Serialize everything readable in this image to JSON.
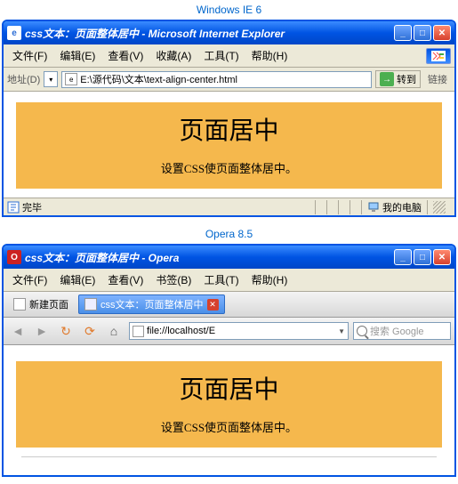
{
  "captions": {
    "ie": "Windows IE 6",
    "opera": "Opera 8.5"
  },
  "ie": {
    "title": "css文本：页面整体居中 - Microsoft Internet Explorer",
    "menu": {
      "file": "文件(F)",
      "edit": "编辑(E)",
      "view": "查看(V)",
      "fav": "收藏(A)",
      "tools": "工具(T)",
      "help": "帮助(H)"
    },
    "addr_label": "地址(D)",
    "url": "E:\\源代码\\文本\\text-align-center.html",
    "go": "转到",
    "links": "链接",
    "heading": "页面居中",
    "subtext": "设置CSS使页面整体居中。",
    "status_done": "完毕",
    "status_zone": "我的电脑"
  },
  "opera": {
    "title": "css文本：页面整体居中 - Opera",
    "menu": {
      "file": "文件(F)",
      "edit": "编辑(E)",
      "view": "查看(V)",
      "bookmarks": "书签(B)",
      "tools": "工具(T)",
      "help": "帮助(H)"
    },
    "newtab": "新建页面",
    "tab_active": "css文本：页面整体居中",
    "url": "file://localhost/E",
    "search_placeholder": "搜索 Google",
    "heading": "页面居中",
    "subtext": "设置CSS使页面整体居中。"
  }
}
